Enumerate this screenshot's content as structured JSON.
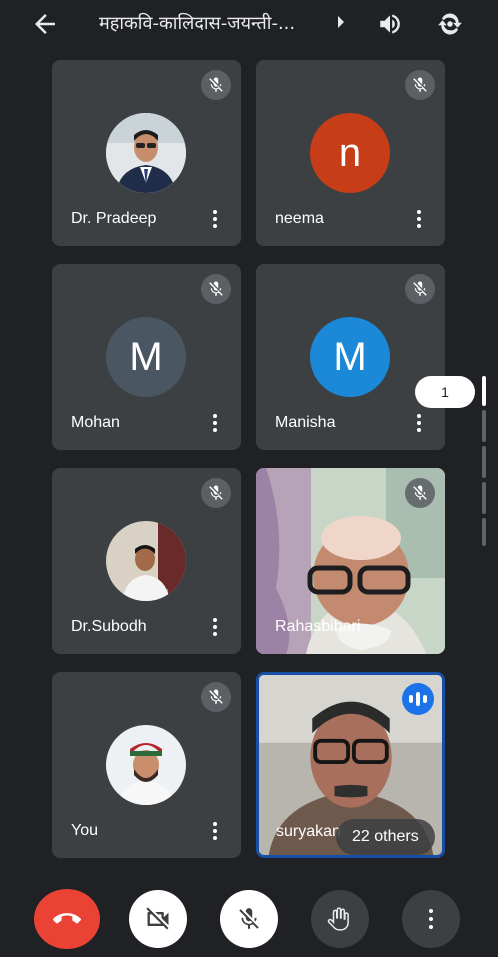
{
  "header": {
    "title": "महाकवि-कालिदास-जयन्ती-..."
  },
  "participants": [
    {
      "name": "Dr. Pradeep",
      "avatar": "photo"
    },
    {
      "name": "neema",
      "initial": "n",
      "color": "#c63d17"
    },
    {
      "name": "Mohan",
      "initial": "M",
      "color": "#4a5763"
    },
    {
      "name": "Manisha",
      "initial": "M",
      "color": "#1c88d8"
    },
    {
      "name": "Dr.Subodh",
      "avatar": "photo"
    },
    {
      "name": "Rahasbihari",
      "avatar": "video"
    },
    {
      "name": "You",
      "avatar": "photo"
    },
    {
      "name": "suryakan",
      "avatar": "video",
      "speaking": true
    }
  ],
  "overflow": {
    "label": "22 others"
  },
  "pager": {
    "page": "1"
  },
  "controls": {
    "end_call": "end-call",
    "camera": "camera-off",
    "mic": "mic-off",
    "hand": "raise-hand",
    "more": "more-options"
  },
  "colors": {
    "background": "#202124",
    "tile": "#3c4043",
    "end_call": "#ea4335",
    "accent": "#1a73e8"
  }
}
